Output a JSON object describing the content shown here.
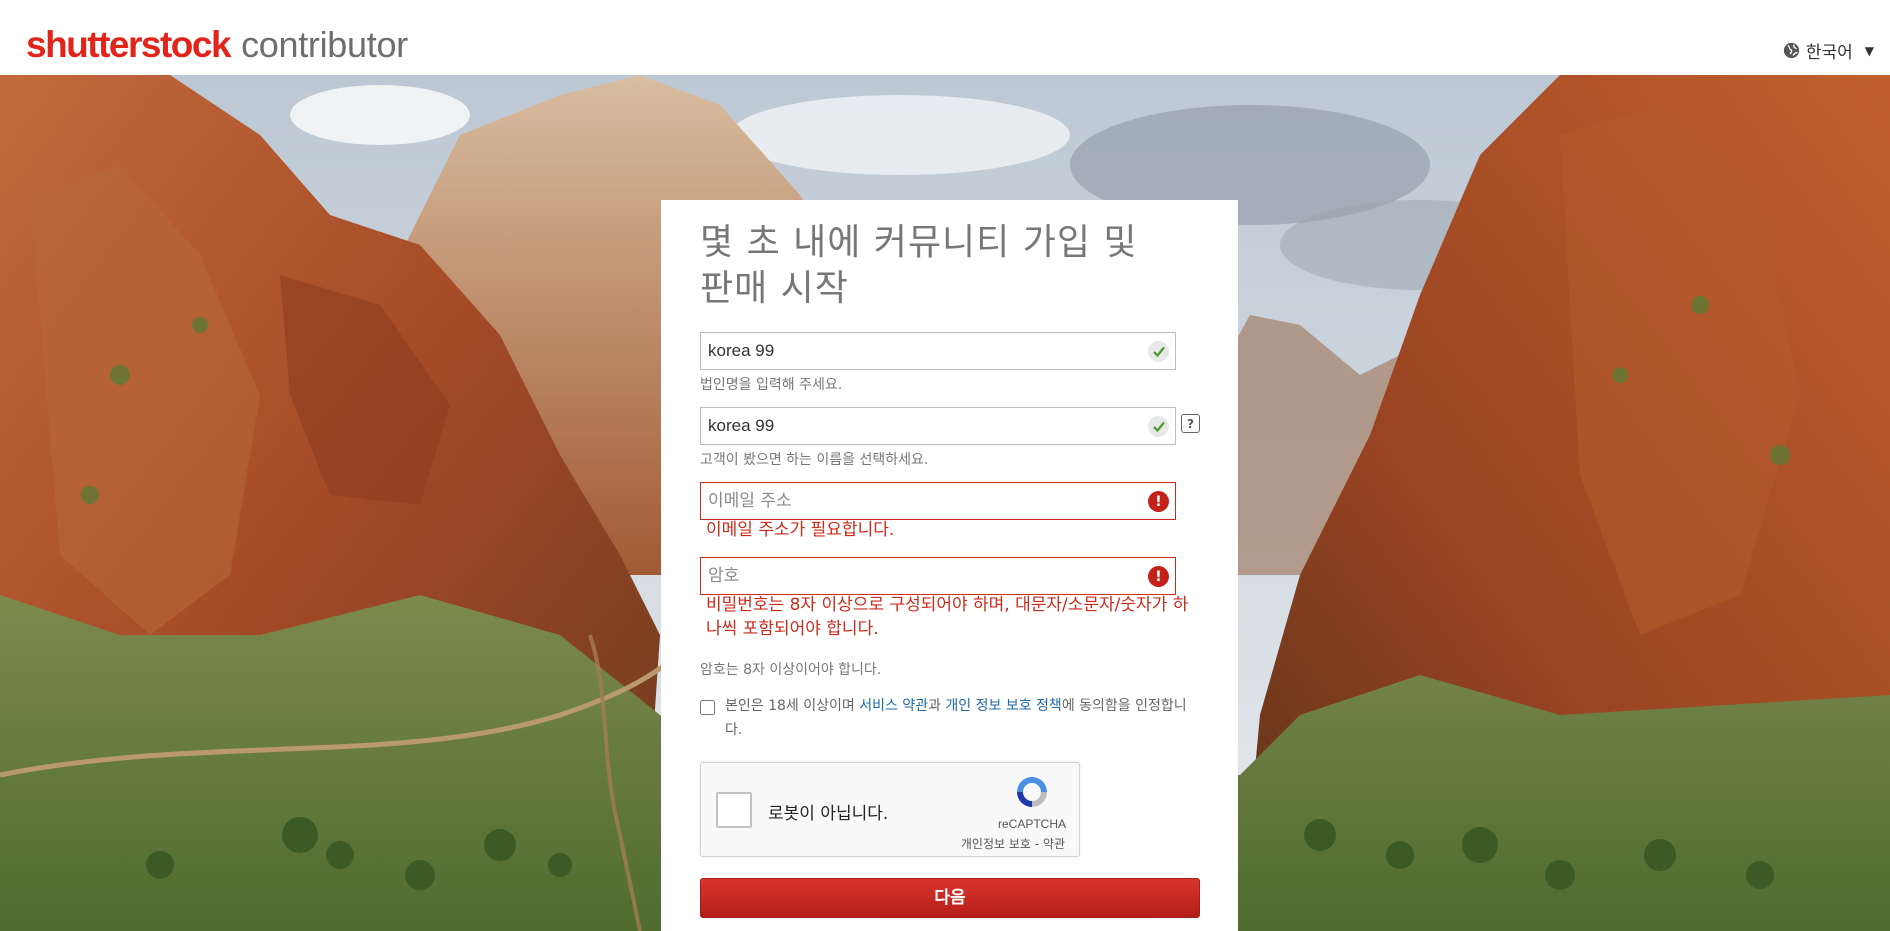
{
  "header": {
    "brand": "shutterstock",
    "product": "contributor",
    "language": "한국어",
    "language_caret": "▼",
    "globe_icon": "globe-icon"
  },
  "form": {
    "title": "몇 초 내에 커뮤니티 가입 및 판매 시작",
    "company_name": {
      "value": "korea 99",
      "help": "법인명을 입력해 주세요.",
      "status": "valid"
    },
    "display_name": {
      "value": "korea 99",
      "help": "고객이 봤으면 하는 이름을 선택하세요.",
      "status": "valid",
      "help_icon": "?"
    },
    "email": {
      "placeholder": "이메일 주소",
      "error": "이메일 주소가 필요합니다.",
      "status": "error"
    },
    "password": {
      "placeholder": "암호",
      "error": "비밀번호는 8자 이상으로 구성되어야 하며, 대문자/소문자/숫자가 하나씩 포함되어야 합니다.",
      "help": "암호는 8자 이상이어야 합니다.",
      "status": "error"
    },
    "agreement": {
      "prefix": "본인은 18세 이상이며 ",
      "terms_link": "서비스 약관",
      "middle": "과 ",
      "privacy_link": "개인 정보 보호 정책",
      "suffix": "에 동의함을 인정합니다.",
      "checked": false
    },
    "captcha": {
      "label": "로봇이 아닙니다.",
      "brand": "reCAPTCHA",
      "links": "개인정보 보호 - 약관"
    },
    "next_button": "다음"
  },
  "colors": {
    "brand_red": "#e1251b",
    "error_red": "#cc2a1b",
    "link_blue": "#1e6aa8",
    "button_red": "#c4271f"
  }
}
